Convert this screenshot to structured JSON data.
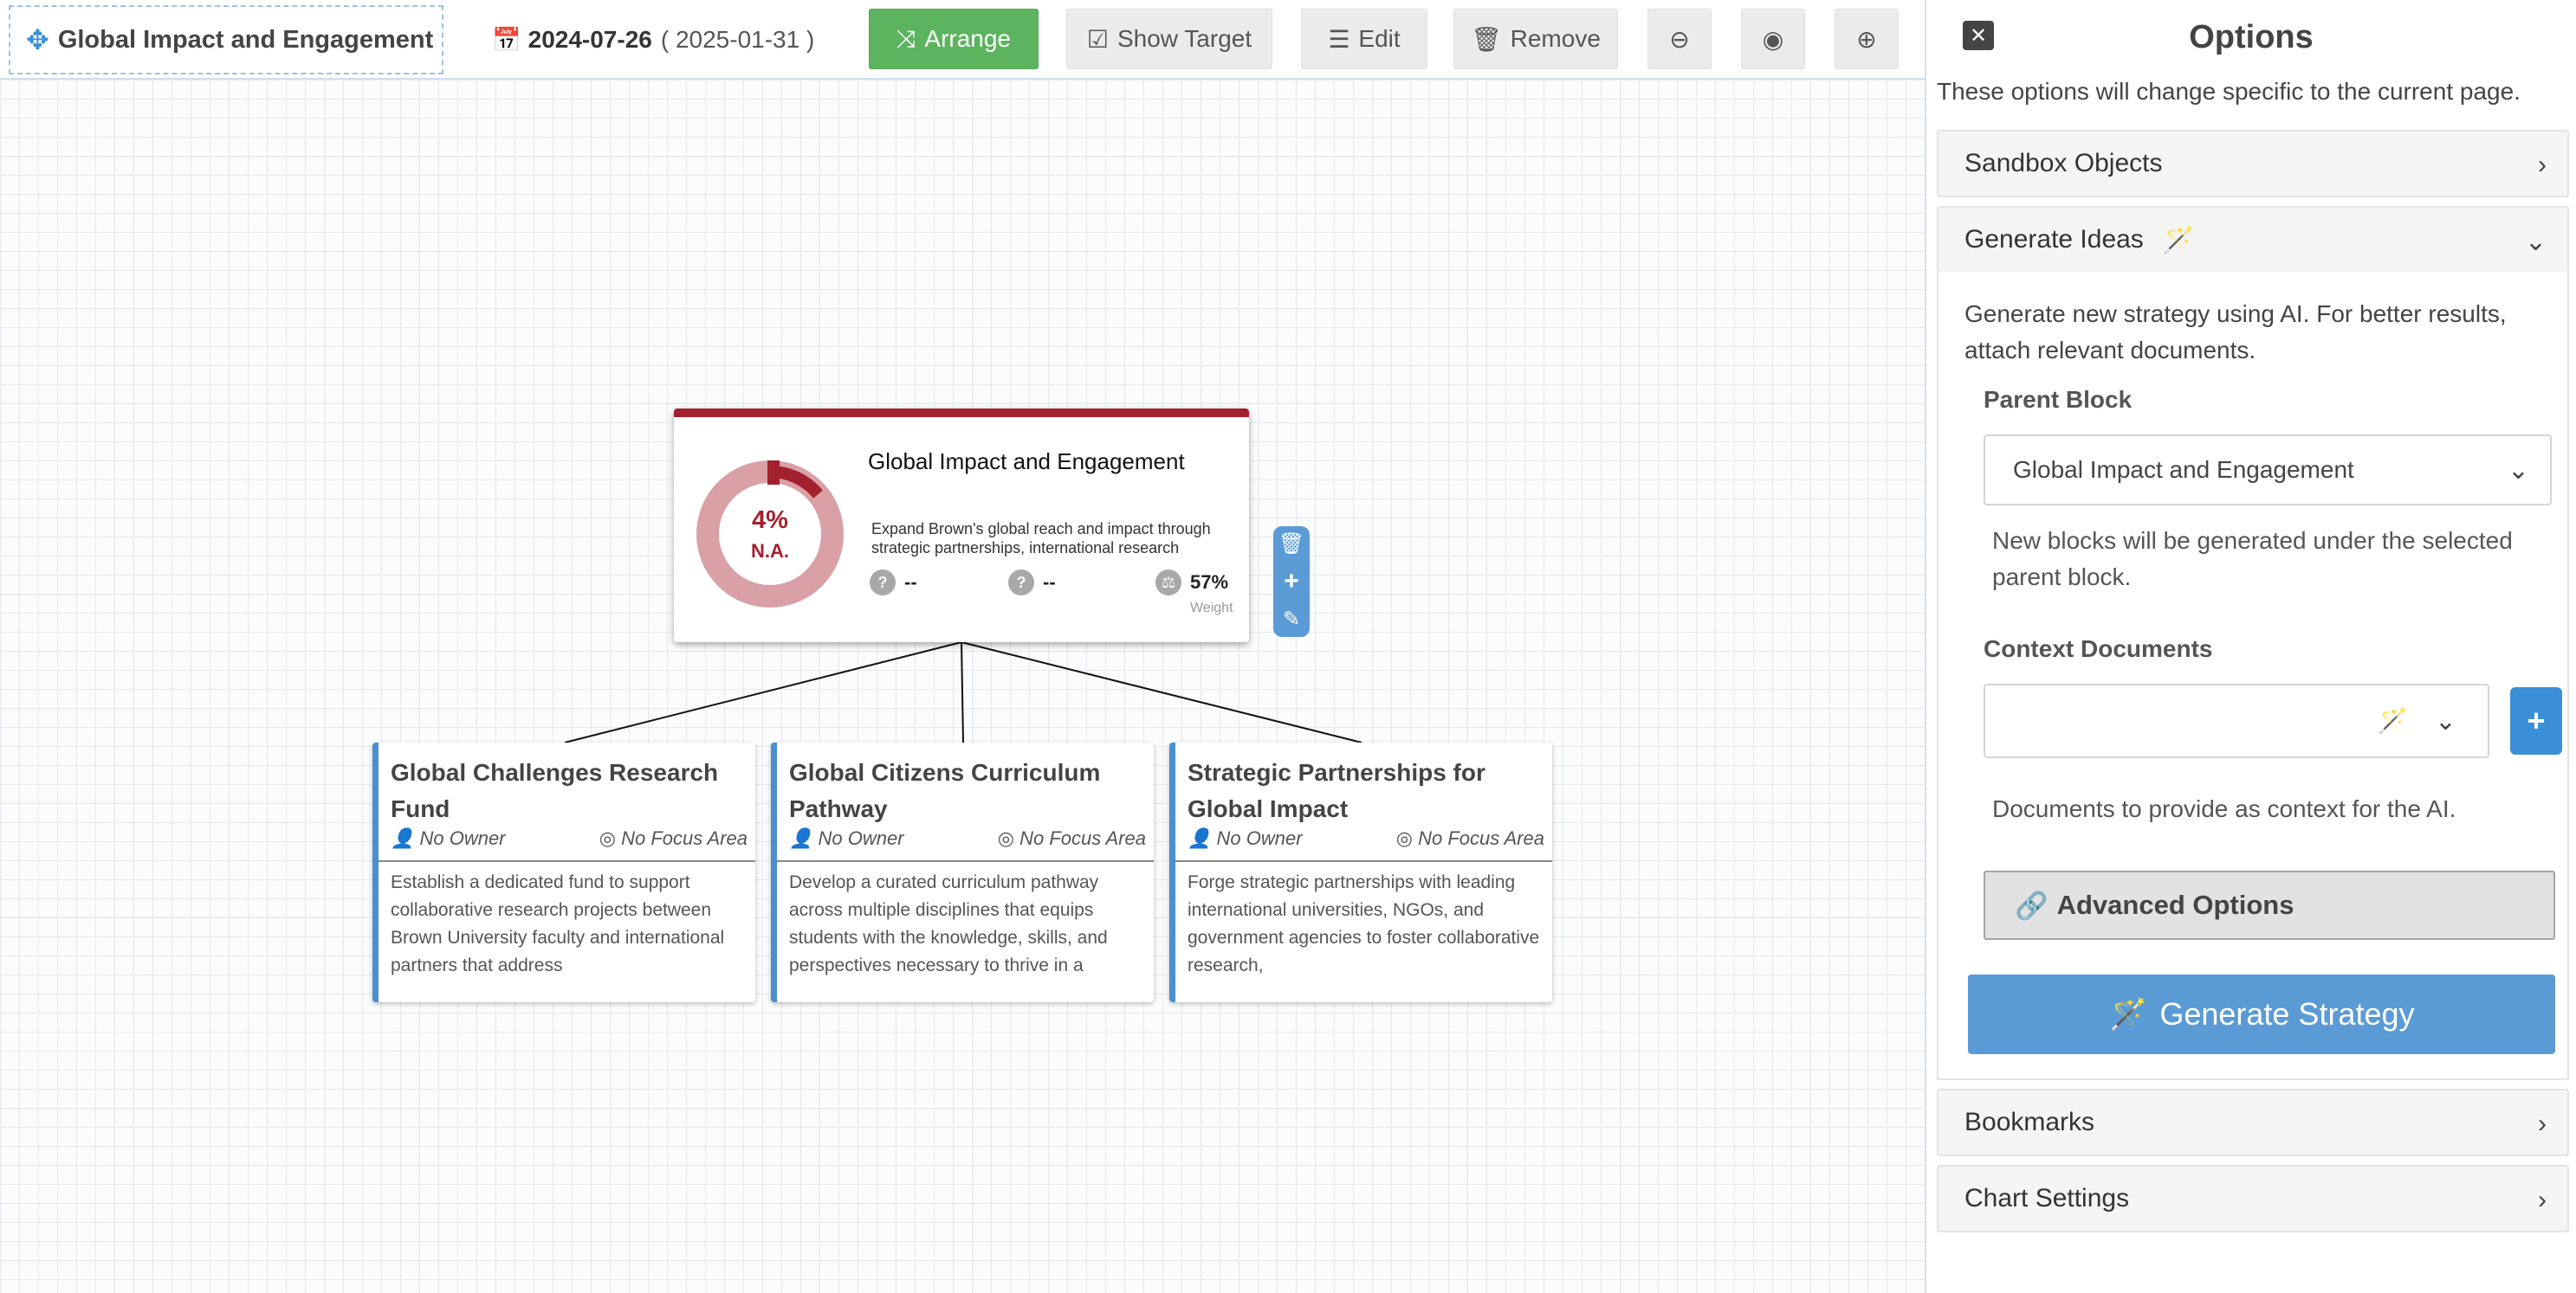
{
  "toolbar": {
    "title": "Global Impact and Engagement",
    "date": "2024-07-26",
    "date_alt": "( 2025-01-31 )",
    "arrange_label": "Arrange",
    "show_target_label": "Show Target",
    "edit_label": "Edit",
    "remove_label": "Remove"
  },
  "root_block": {
    "title": "Global Impact and Engagement",
    "description": "Expand Brown's global reach and impact through strategic partnerships, international research",
    "progress_label": "4%",
    "progress_value": 0.04,
    "status_label": "N.A.",
    "metric1": "--",
    "metric2": "--",
    "weight_value": "57%",
    "weight_label": "Weight",
    "color": "#a3202e"
  },
  "children": [
    {
      "title": "Global Challenges Research Fund",
      "owner": "No Owner",
      "focus": "No Focus Area",
      "description": "Establish a dedicated fund to support collaborative research projects between Brown University faculty and international partners that address"
    },
    {
      "title": "Global Citizens Curriculum Pathway",
      "owner": "No Owner",
      "focus": "No Focus Area",
      "description": "Develop a curated curriculum pathway across multiple disciplines that equips students with the knowledge, skills, and perspectives necessary to thrive in a"
    },
    {
      "title": "Strategic Partnerships for Global Impact",
      "owner": "No Owner",
      "focus": "No Focus Area",
      "description": "Forge strategic partnerships with leading international universities, NGOs, and government agencies to foster collaborative research,"
    }
  ],
  "panel": {
    "title": "Options",
    "subtitle": "These options will change specific to the current page.",
    "sandbox_label": "Sandbox Objects",
    "generate_label": "Generate Ideas",
    "generate_desc": "Generate new strategy using AI. For better results, attach relevant documents.",
    "parent_label": "Parent Block",
    "parent_value": "Global Impact and Engagement",
    "parent_hint": "New blocks will be generated under the selected parent block.",
    "context_label": "Context Documents",
    "context_hint": "Documents to provide as context for the AI.",
    "advanced_label": "Advanced Options",
    "generate_button": "Generate Strategy",
    "bookmarks_label": "Bookmarks",
    "chart_settings_label": "Chart Settings"
  },
  "colors": {
    "accent": "#5b9bd5",
    "brand_red": "#a3202e",
    "arrange_green": "#5cb45f"
  }
}
